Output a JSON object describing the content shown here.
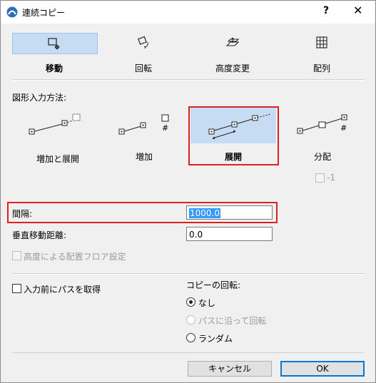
{
  "window": {
    "title": "連続コピー",
    "help": "?",
    "close": "✕"
  },
  "tools": [
    {
      "label": "移動",
      "selected": true
    },
    {
      "label": "回転",
      "selected": false
    },
    {
      "label": "高度変更",
      "selected": false
    },
    {
      "label": "配列",
      "selected": false
    }
  ],
  "input_method": {
    "heading": "図形入力方法:",
    "modes": [
      {
        "label": "増加と展開",
        "selected": false
      },
      {
        "label": "増加",
        "selected": false
      },
      {
        "label": "展開",
        "selected": true
      },
      {
        "label": "分配",
        "selected": false
      }
    ],
    "hash_symbol": "#",
    "minus_one_label": "-1"
  },
  "spacing": {
    "label": "間隔:",
    "value": "1000.0"
  },
  "vertical_offset": {
    "label": "垂直移動距離:",
    "value": "0.0"
  },
  "elevation_floor": {
    "label": "高度による配置フロア設定",
    "checked": false,
    "enabled": false
  },
  "get_path": {
    "label": "入力前にパスを取得",
    "checked": false
  },
  "copy_rotation": {
    "heading": "コピーの回転:",
    "options": [
      {
        "label": "なし",
        "checked": true,
        "enabled": true
      },
      {
        "label": "パスに沿って回転",
        "checked": false,
        "enabled": false
      },
      {
        "label": "ランダム",
        "checked": false,
        "enabled": true
      }
    ]
  },
  "buttons": {
    "cancel": "キャンセル",
    "ok": "OK"
  },
  "colors": {
    "selection": "#c5dcf2",
    "highlight_frame": "#e02020",
    "text_highlight": "#3399ff",
    "default_button_border": "#0078d7"
  }
}
